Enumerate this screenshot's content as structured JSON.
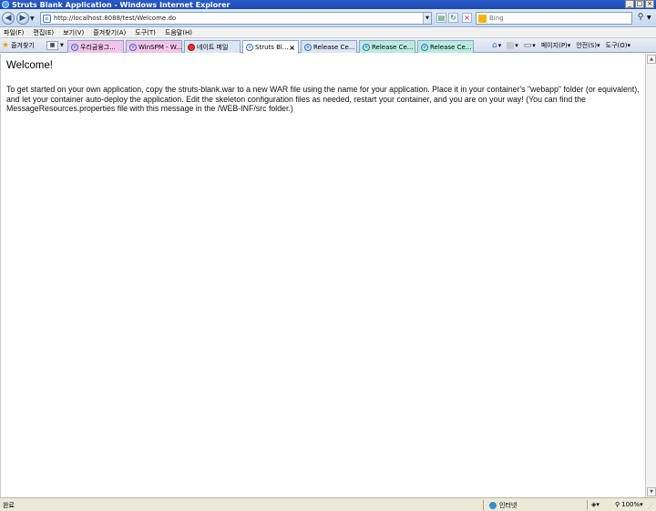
{
  "window": {
    "title": "Struts Blank Application - Windows Internet Explorer",
    "icon": "ie-icon"
  },
  "addressbar": {
    "url": "http://localhost:8088/test/Welcome.do",
    "search_placeholder": "Bing"
  },
  "menu": [
    "파일(F)",
    "편집(E)",
    "보기(V)",
    "즐겨찾기(A)",
    "도구(T)",
    "도움말(H)"
  ],
  "favorites_label": "즐겨찾기",
  "tabs": [
    {
      "label": "우리금융그...",
      "color": "#f3c4e9"
    },
    {
      "label": "WinSPM - W...",
      "color": "#f3c4e9"
    },
    {
      "label": "네이트 메일",
      "color": "#dce5f2"
    },
    {
      "label": "Struts Bl...",
      "color": "#ffffff",
      "active": true
    },
    {
      "label": "Release Ce...",
      "color": "#dce5f2"
    },
    {
      "label": "Release Ce...",
      "color": "#b9ecdf"
    },
    {
      "label": "Release Ce...",
      "color": "#b9ecdf"
    }
  ],
  "command_bar": {
    "page": "페이지(P)",
    "safety": "안전(S)",
    "tools": "도구(O)"
  },
  "content": {
    "heading": "Welcome!",
    "body": "To get started on your own application, copy the struts-blank.war to a new WAR file using the name for your application. Place it in your container's \"webapp\" folder (or equivalent), and let your container auto-deploy the application. Edit the skeleton configuration files as needed, restart your container, and you are on your way! (You can find the MessageResources.properties file with this message in the /WEB-INF/src folder.)"
  },
  "statusbar": {
    "status": "완료",
    "zone": "인터넷",
    "zoom": "100%"
  }
}
